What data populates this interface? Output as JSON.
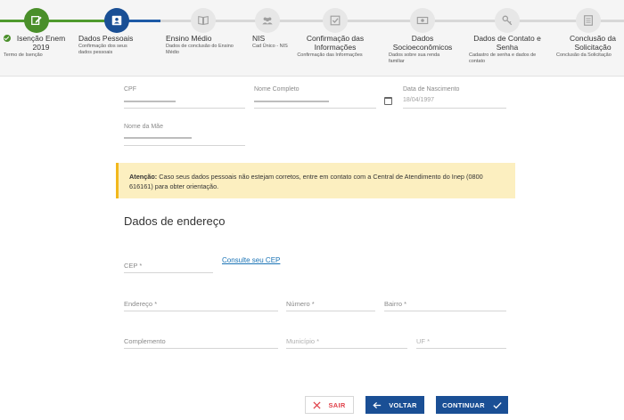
{
  "stepper": {
    "steps": [
      {
        "title": "Isenção Enem 2019",
        "subtitle": "Termo de Isenção",
        "state": "done",
        "icon": "edit-icon"
      },
      {
        "title": "Dados Pessoais",
        "subtitle": "Confirmação dos seus dados pessoais",
        "state": "active",
        "icon": "id-card-icon"
      },
      {
        "title": "Ensino Médio",
        "subtitle": "Dados de conclusão do Ensino Médio",
        "state": "pending",
        "icon": "book-icon"
      },
      {
        "title": "NIS",
        "subtitle": "Cad Único - NIS",
        "state": "pending",
        "icon": "group-icon"
      },
      {
        "title": "Confirmação das Informações",
        "subtitle": "Confirmação das Informações",
        "state": "pending",
        "icon": "checkbox-icon"
      },
      {
        "title": "Dados Socioeconômicos",
        "subtitle": "Dados sobre sua renda familiar",
        "state": "pending",
        "icon": "money-icon"
      },
      {
        "title": "Dados de Contato e Senha",
        "subtitle": "Cadastro de senha e dados de contato",
        "state": "pending",
        "icon": "key-icon"
      },
      {
        "title": "Conclusão da Solicitação",
        "subtitle": "Conclusão da Solicitação",
        "state": "pending",
        "icon": "document-icon"
      }
    ]
  },
  "personal": {
    "cpf_label": "CPF",
    "cpf_value": "",
    "name_label": "Nome Completo",
    "name_value": "",
    "birth_label": "Data de Nascimento",
    "birth_value": "18/04/1997",
    "mother_label": "Nome da Mãe",
    "mother_value": ""
  },
  "alert": {
    "strong": "Atenção:",
    "text": " Caso seus dados pessoais não estejam corretos, entre em contato com a Central de Atendimento do Inep (0800 616161) para obter orientação."
  },
  "address": {
    "title": "Dados de endereço",
    "cep_label": "CEP *",
    "cep_link": "Consulte seu CEP",
    "endereco_label": "Endereço *",
    "numero_label": "Número *",
    "bairro_label": "Bairro *",
    "complemento_label": "Complemento",
    "municipio_label": "Município *",
    "uf_label": "UF *"
  },
  "actions": {
    "sair": "SAIR",
    "voltar": "VOLTAR",
    "continuar": "CONTINUAR"
  },
  "colors": {
    "done": "#4a8f2a",
    "active": "#1a4f95",
    "alert_bg": "#fcefc0",
    "alert_border": "#f2b81d",
    "link": "#1a73b5",
    "sair": "#e0414a"
  }
}
